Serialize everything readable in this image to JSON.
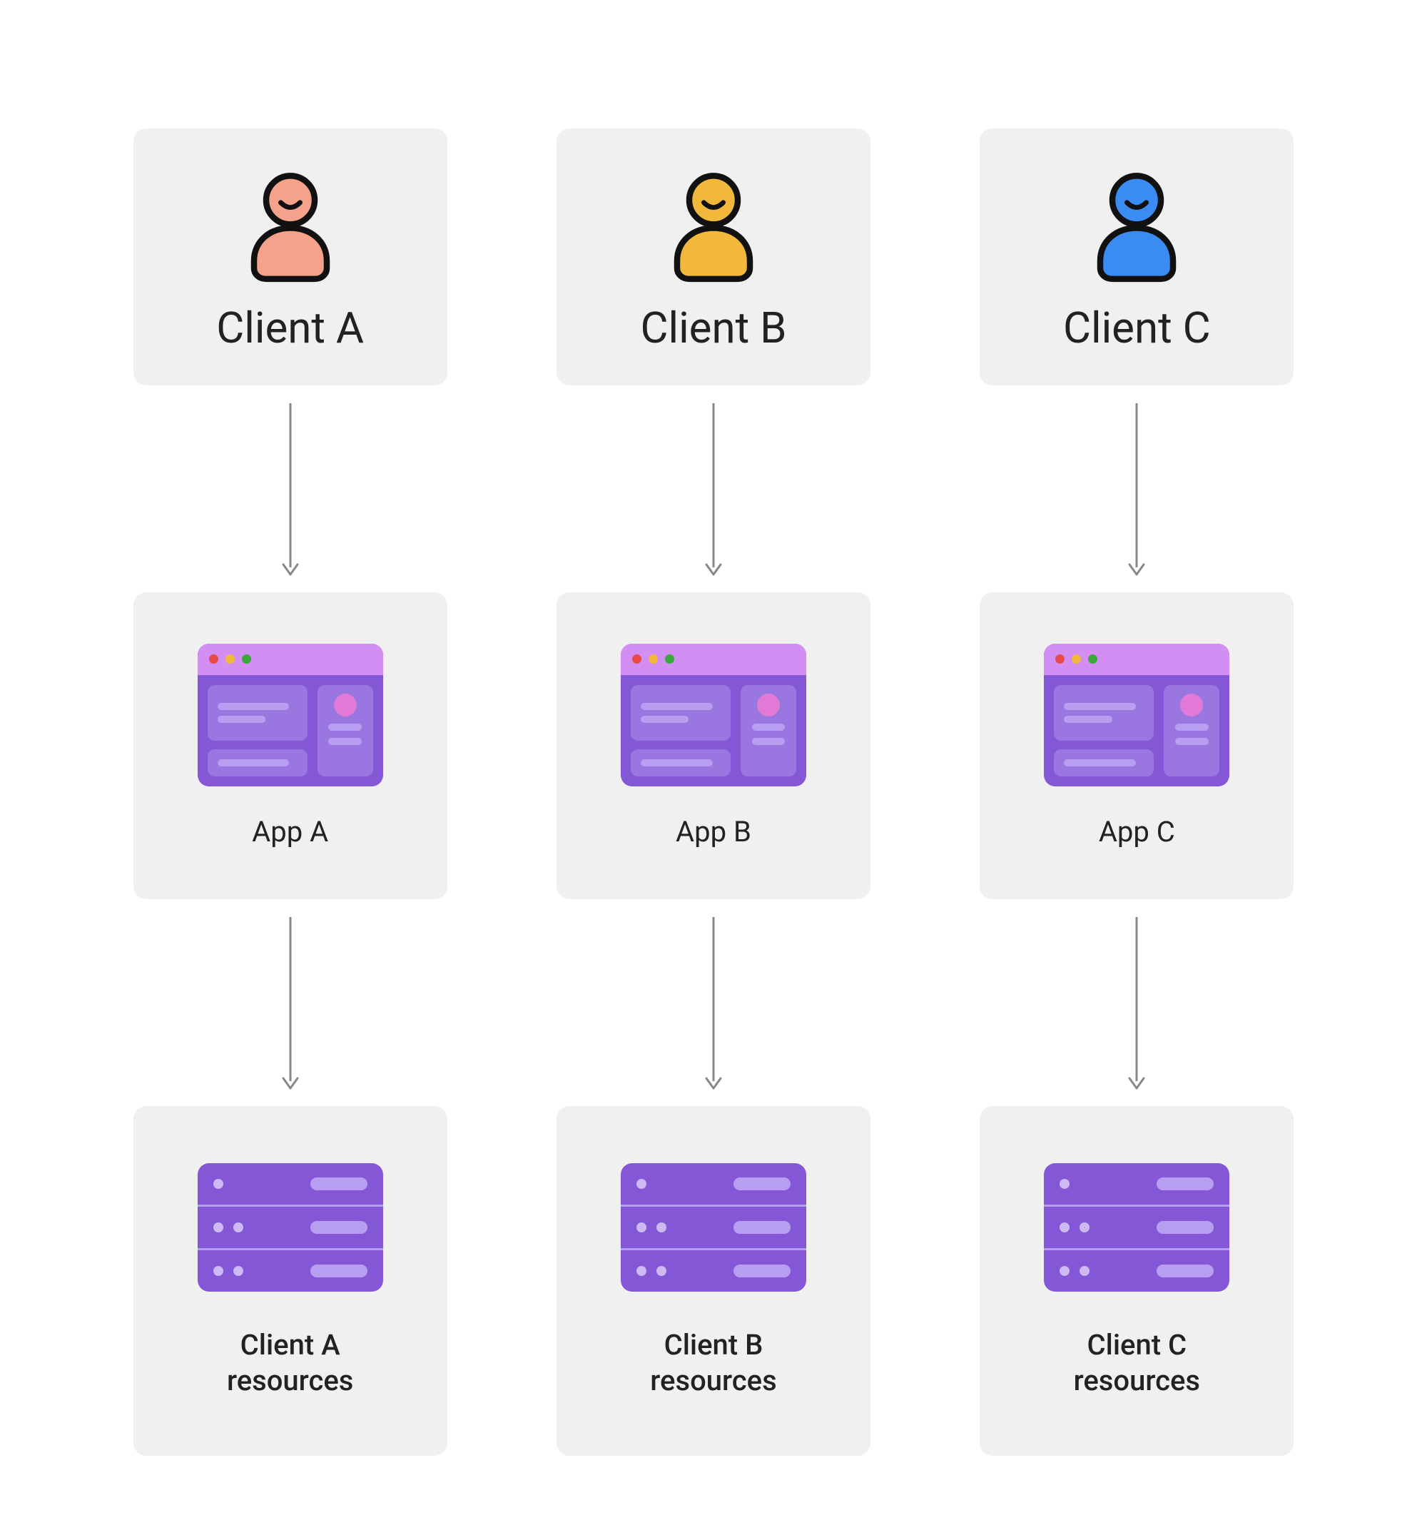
{
  "columns": [
    {
      "client_label": "Client A",
      "client_color": "#f4a28a",
      "app_label": "App A",
      "resources_label": "Client A\nresources"
    },
    {
      "client_label": "Client B",
      "client_color": "#f2b83b",
      "app_label": "App B",
      "resources_label": "Client B\nresources"
    },
    {
      "client_label": "Client C",
      "client_color": "#3b8cf2",
      "app_label": "App C",
      "resources_label": "Client C\nresources"
    }
  ]
}
